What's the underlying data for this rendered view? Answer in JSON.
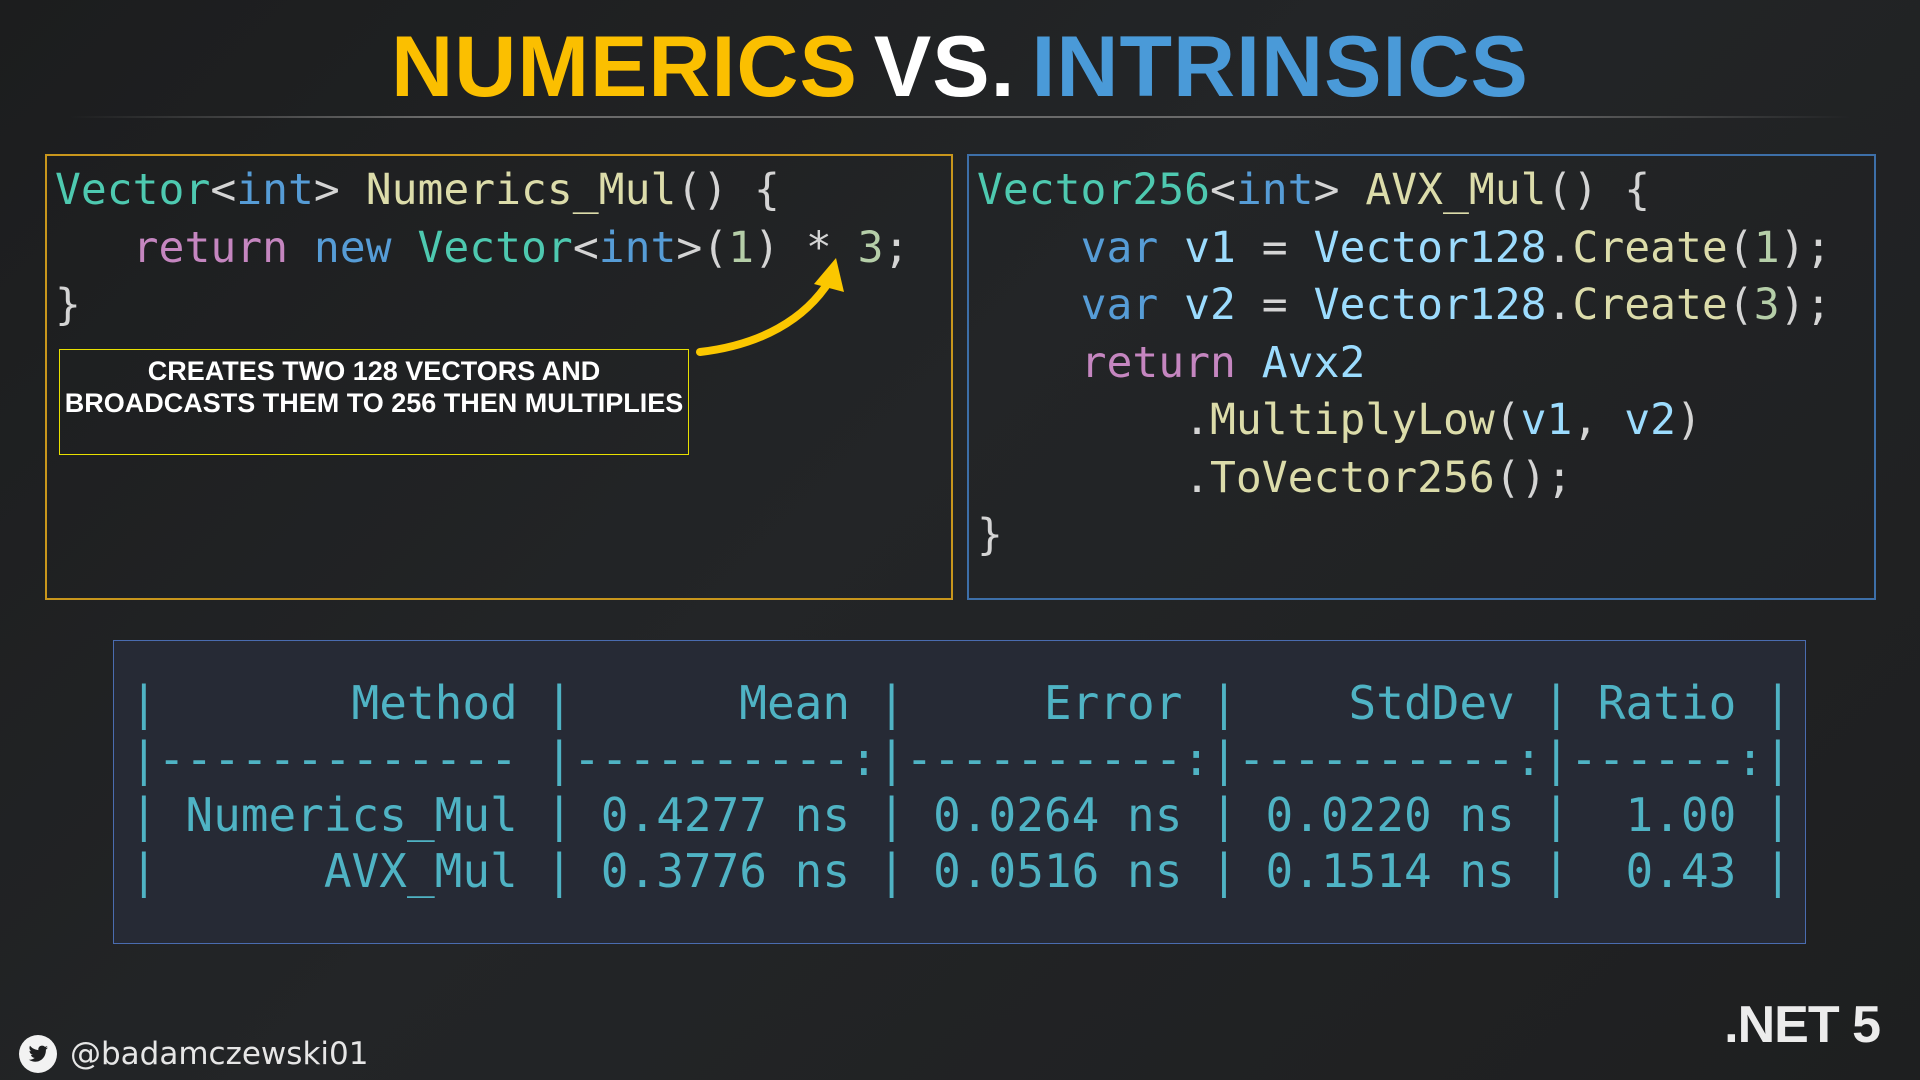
{
  "title": {
    "part1": "NUMERICS",
    "part2": "VS.",
    "part3": "INTRINSICS",
    "colors": {
      "part1": "#fbbf00",
      "part2": "#ffffff",
      "part3": "#4a9ad8"
    }
  },
  "left_code": {
    "lines": [
      [
        [
          "Vector",
          "t-type"
        ],
        [
          "<",
          "t-p"
        ],
        [
          "int",
          "t-kw"
        ],
        [
          "> ",
          "t-p"
        ],
        [
          "Numerics_Mul",
          "t-fn"
        ],
        [
          "() {",
          "t-p"
        ]
      ],
      [
        [
          "   ",
          "t-p"
        ],
        [
          "return",
          "t-ret"
        ],
        [
          " ",
          "t-p"
        ],
        [
          "new",
          "t-kw"
        ],
        [
          " ",
          "t-p"
        ],
        [
          "Vector",
          "t-type"
        ],
        [
          "<",
          "t-p"
        ],
        [
          "int",
          "t-kw"
        ],
        [
          ">(",
          "t-p"
        ],
        [
          "1",
          "t-num"
        ],
        [
          ") * ",
          "t-p"
        ],
        [
          "3",
          "t-num"
        ],
        [
          ";",
          "t-p"
        ]
      ],
      [
        [
          "}",
          "t-p"
        ]
      ]
    ]
  },
  "callout": {
    "text": "Creates two 128 vectors and broadcasts them to 256 then multiplies"
  },
  "right_code": {
    "lines": [
      [
        [
          "Vector256",
          "t-type"
        ],
        [
          "<",
          "t-p"
        ],
        [
          "int",
          "t-kw"
        ],
        [
          "> ",
          "t-p"
        ],
        [
          "AVX_Mul",
          "t-fn"
        ],
        [
          "() {",
          "t-p"
        ]
      ],
      [
        [
          "    ",
          "t-p"
        ],
        [
          "var",
          "t-kw"
        ],
        [
          " ",
          "t-p"
        ],
        [
          "v1",
          "t-var"
        ],
        [
          " = ",
          "t-p"
        ],
        [
          "Vector128",
          "t-var"
        ],
        [
          ".",
          "t-p"
        ],
        [
          "Create",
          "t-fn"
        ],
        [
          "(",
          "t-p"
        ],
        [
          "1",
          "t-num"
        ],
        [
          ");",
          "t-p"
        ]
      ],
      [
        [
          "    ",
          "t-p"
        ],
        [
          "var",
          "t-kw"
        ],
        [
          " ",
          "t-p"
        ],
        [
          "v2",
          "t-var"
        ],
        [
          " = ",
          "t-p"
        ],
        [
          "Vector128",
          "t-var"
        ],
        [
          ".",
          "t-p"
        ],
        [
          "Create",
          "t-fn"
        ],
        [
          "(",
          "t-p"
        ],
        [
          "3",
          "t-num"
        ],
        [
          ");",
          "t-p"
        ]
      ],
      [
        [
          "    ",
          "t-p"
        ],
        [
          "return",
          "t-ret"
        ],
        [
          " ",
          "t-p"
        ],
        [
          "Avx2",
          "t-var"
        ]
      ],
      [
        [
          "        .",
          "t-p"
        ],
        [
          "MultiplyLow",
          "t-fn"
        ],
        [
          "(",
          "t-p"
        ],
        [
          "v1",
          "t-var"
        ],
        [
          ", ",
          "t-p"
        ],
        [
          "v2",
          "t-var"
        ],
        [
          ")",
          "t-p"
        ]
      ],
      [
        [
          "        .",
          "t-p"
        ],
        [
          "ToVector256",
          "t-fn"
        ],
        [
          "();",
          "t-p"
        ]
      ],
      [
        [
          "}",
          "t-p"
        ]
      ]
    ]
  },
  "benchmark": {
    "columns": [
      "Method",
      "Mean",
      "Error",
      "StdDev",
      "Ratio"
    ],
    "rows": [
      [
        "Numerics_Mul",
        "0.4277 ns",
        "0.0264 ns",
        "0.0220 ns",
        "1.00"
      ],
      [
        "AVX_Mul",
        "0.3776 ns",
        "0.0516 ns",
        "0.1514 ns",
        "0.43"
      ]
    ]
  },
  "footer": {
    "twitter_handle": "@badamczewski01",
    "platform": ".NET 5",
    "icon": "twitter-bird-icon"
  }
}
